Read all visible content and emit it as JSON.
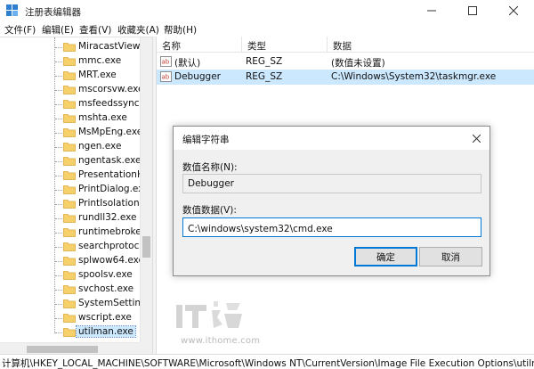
{
  "window": {
    "title": "注册表编辑器"
  },
  "menu": {
    "items": [
      "文件(F)",
      "编辑(E)",
      "查看(V)",
      "收藏夹(A)",
      "帮助(H)"
    ]
  },
  "tree": {
    "items": [
      {
        "label": "MiracastView.e"
      },
      {
        "label": "mmc.exe"
      },
      {
        "label": "MRT.exe"
      },
      {
        "label": "mscorsvw.exe"
      },
      {
        "label": "msfeedssync.ex"
      },
      {
        "label": "mshta.exe"
      },
      {
        "label": "MsMpEng.exe"
      },
      {
        "label": "ngen.exe"
      },
      {
        "label": "ngentask.exe"
      },
      {
        "label": "PresentationHo"
      },
      {
        "label": "PrintDialog.exe"
      },
      {
        "label": "PrintIsolationHo"
      },
      {
        "label": "rundll32.exe"
      },
      {
        "label": "runtimebroker."
      },
      {
        "label": "searchprotocol"
      },
      {
        "label": "splwow64.exe"
      },
      {
        "label": "spoolsv.exe"
      },
      {
        "label": "svchost.exe"
      },
      {
        "label": "SystemSettings"
      },
      {
        "label": "wscript.exe"
      },
      {
        "label": "utilman.exe",
        "selected": true
      }
    ]
  },
  "values": {
    "headers": {
      "name": "名称",
      "type": "类型",
      "data": "数据"
    },
    "rows": [
      {
        "name": "(默认)",
        "type": "REG_SZ",
        "data": "(数值未设置)"
      },
      {
        "name": "Debugger",
        "type": "REG_SZ",
        "data": "C:\\Windows\\System32\\taskmgr.exe",
        "selected": true
      }
    ]
  },
  "dialog": {
    "title": "编辑字符串",
    "name_label": "数值名称(N):",
    "name_value": "Debugger",
    "data_label": "数值数据(V):",
    "data_value": "C:\\windows\\system32\\cmd.exe",
    "ok_label": "确定",
    "cancel_label": "取消"
  },
  "statusbar": {
    "path": "计算机\\HKEY_LOCAL_MACHINE\\SOFTWARE\\Microsoft\\Windows NT\\CurrentVersion\\Image File Execution Options\\utilman.exe"
  },
  "watermark": {
    "text": "www.ithome.com"
  },
  "colors": {
    "selection": "#cce8ff",
    "accent": "#0078d7",
    "folder": "#f6d06a"
  }
}
